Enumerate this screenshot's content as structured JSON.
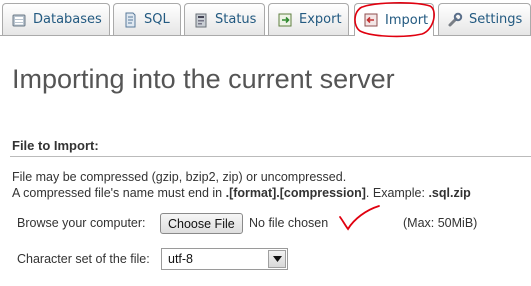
{
  "tabs": [
    {
      "label": "Databases",
      "icon": "databases-icon"
    },
    {
      "label": "SQL",
      "icon": "sql-icon"
    },
    {
      "label": "Status",
      "icon": "status-icon"
    },
    {
      "label": "Export",
      "icon": "export-icon"
    },
    {
      "label": "Import",
      "icon": "import-icon",
      "active": true
    },
    {
      "label": "Settings",
      "icon": "settings-icon"
    }
  ],
  "page_title": "Importing into the current server",
  "file_section": {
    "title": "File to Import:",
    "desc_line1": "File may be compressed (gzip, bzip2, zip) or uncompressed.",
    "desc_line2_prefix": "A compressed file's name must end in ",
    "desc_line2_format": ".[format].[compression]",
    "desc_line2_middle": ". Example: ",
    "desc_line2_example": ".sql.zip",
    "browse_label": "Browse your computer:",
    "choose_file_label": "Choose File",
    "no_file_text": "No file chosen",
    "max_size": "(Max: 50MiB)",
    "charset_label": "Character set of the file:",
    "charset_value": "utf-8"
  },
  "colors": {
    "tab_text": "#235a81",
    "annotation_red": "#e0000f",
    "heading_gray": "#555555"
  }
}
